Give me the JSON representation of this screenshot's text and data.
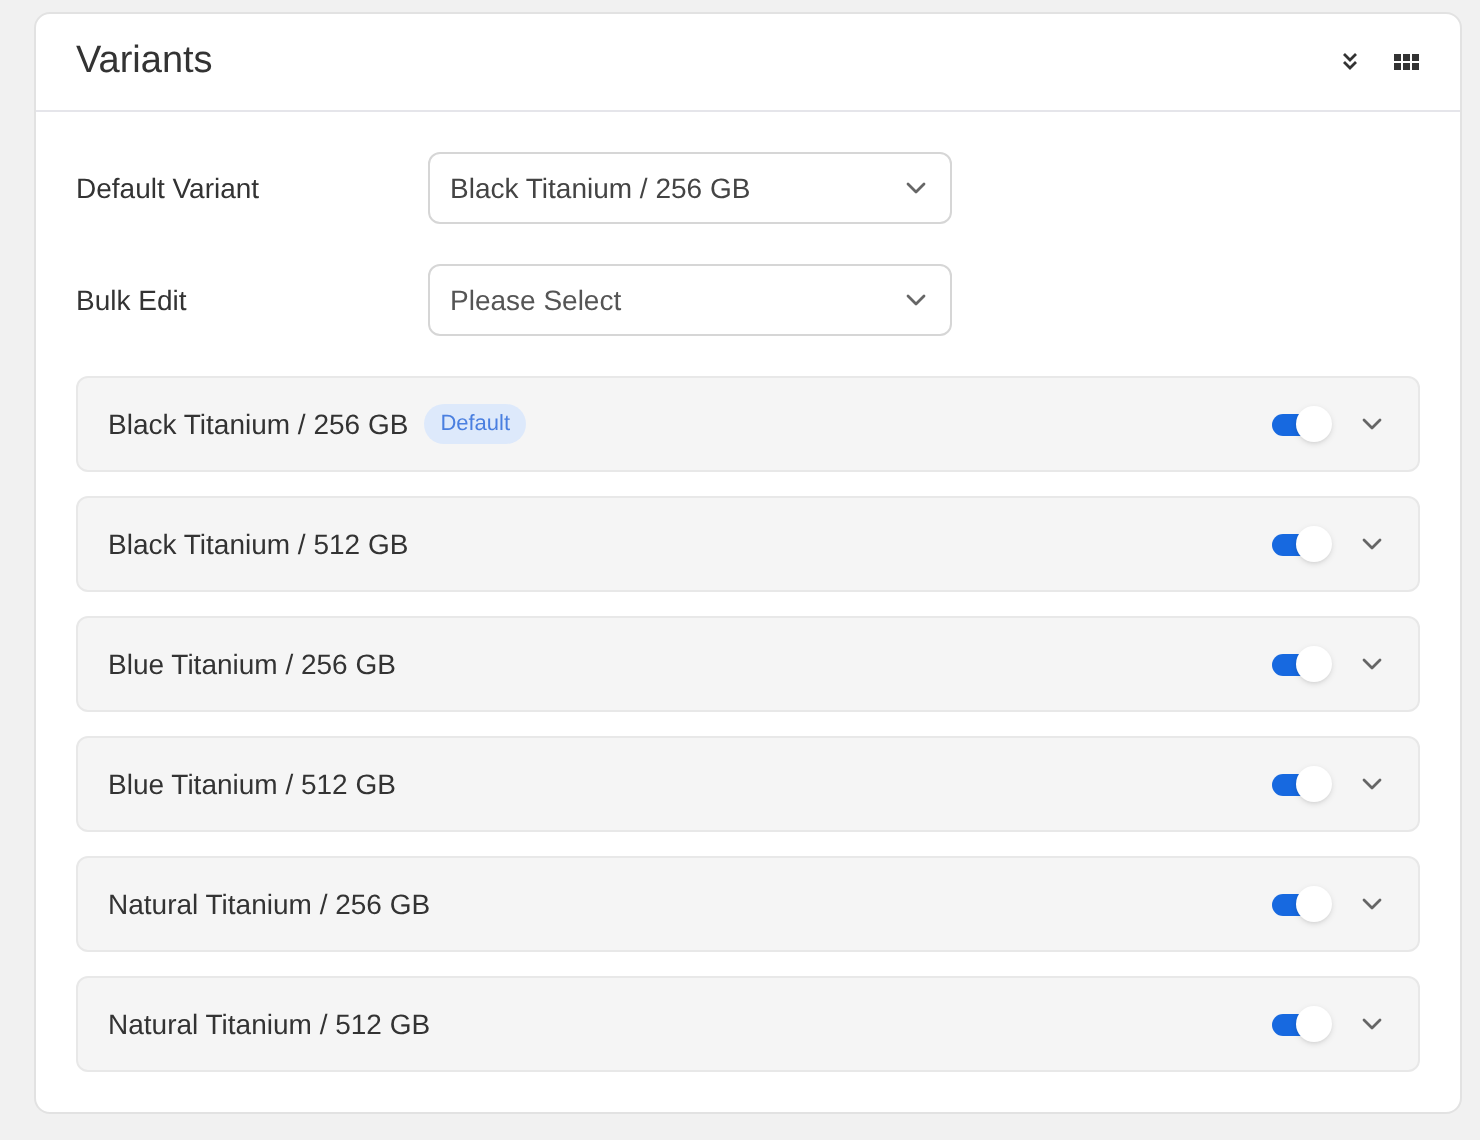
{
  "panel": {
    "title": "Variants"
  },
  "fields": [
    {
      "label": "Default Variant",
      "value": "Black Titanium / 256 GB"
    },
    {
      "label": "Bulk Edit",
      "placeholder": "Please Select"
    }
  ],
  "variants": [
    {
      "name": "Black Titanium / 256 GB",
      "badge": "Default",
      "enabled": true,
      "expanded": false
    },
    {
      "name": "Black Titanium / 512 GB",
      "enabled": true,
      "expanded": false
    },
    {
      "name": "Blue Titanium / 256 GB",
      "enabled": true,
      "expanded": false
    },
    {
      "name": "Blue Titanium / 512 GB",
      "enabled": true,
      "expanded": false
    },
    {
      "name": "Natural Titanium / 256 GB",
      "enabled": true,
      "expanded": false
    },
    {
      "name": "Natural Titanium / 512 GB",
      "enabled": true,
      "expanded": false
    }
  ]
}
